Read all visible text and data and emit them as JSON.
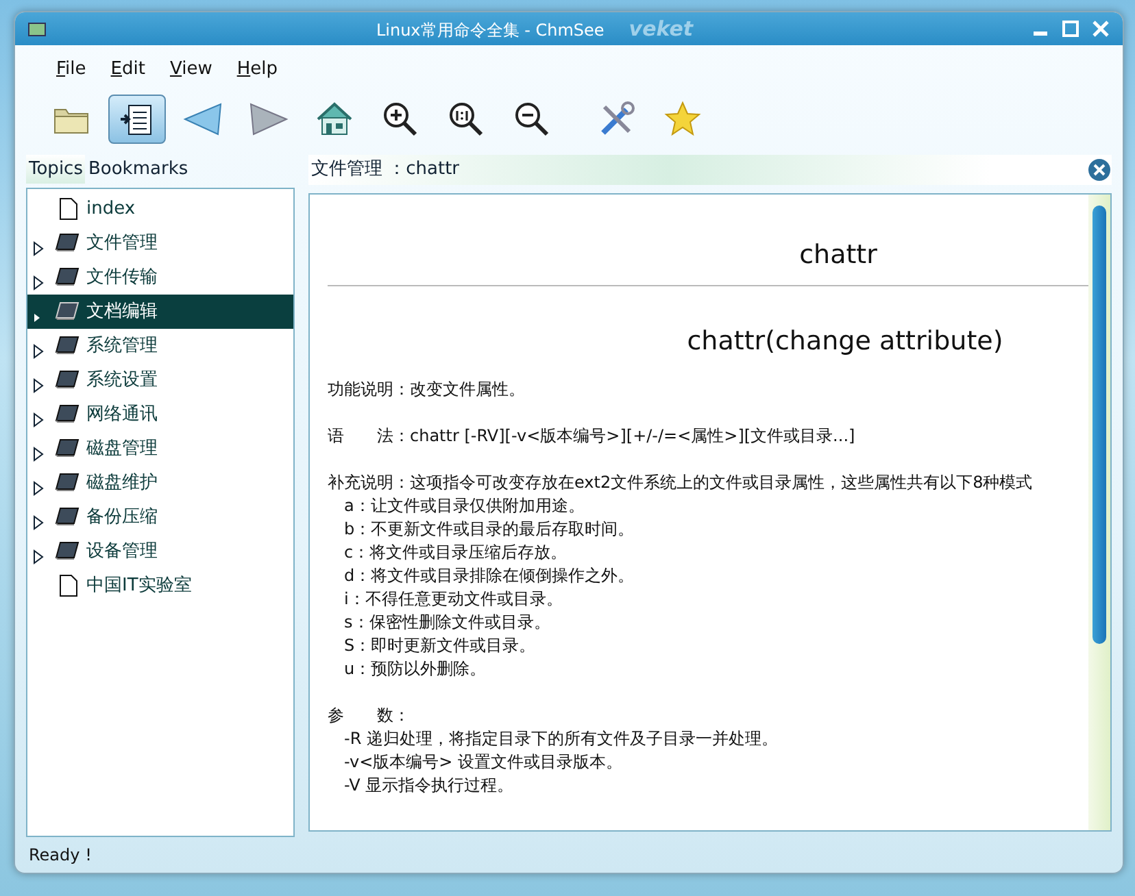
{
  "window": {
    "title": "Linux常用命令全集 - ChmSee",
    "theme_logo": "veket"
  },
  "menu": [
    "File",
    "Edit",
    "View",
    "Help"
  ],
  "toolbar": [
    {
      "kind": "open",
      "selected": false
    },
    {
      "kind": "sidebar",
      "selected": true
    },
    {
      "kind": "back",
      "selected": false
    },
    {
      "kind": "forward",
      "selected": false
    },
    {
      "kind": "home",
      "selected": false
    },
    {
      "kind": "zoom-in",
      "selected": false
    },
    {
      "kind": "zoom-reset",
      "selected": false
    },
    {
      "kind": "zoom-out",
      "selected": false
    },
    {
      "kind": "tools",
      "selected": false
    },
    {
      "kind": "bookmark",
      "selected": false
    }
  ],
  "sidebar": {
    "tabs": [
      {
        "label": "Topics",
        "selected": true
      },
      {
        "label": "Bookmarks",
        "selected": false
      }
    ],
    "items": [
      {
        "label": "index",
        "kind": "page",
        "selected": false
      },
      {
        "label": "文件管理",
        "kind": "book",
        "selected": false
      },
      {
        "label": "文件传输",
        "kind": "book",
        "selected": false
      },
      {
        "label": "文档编辑",
        "kind": "book",
        "selected": true
      },
      {
        "label": "系统管理",
        "kind": "book",
        "selected": false
      },
      {
        "label": "系统设置",
        "kind": "book",
        "selected": false
      },
      {
        "label": "网络通讯",
        "kind": "book",
        "selected": false
      },
      {
        "label": "磁盘管理",
        "kind": "book",
        "selected": false
      },
      {
        "label": "磁盘维护",
        "kind": "book",
        "selected": false
      },
      {
        "label": "备份压缩",
        "kind": "book",
        "selected": false
      },
      {
        "label": "设备管理",
        "kind": "book",
        "selected": false
      },
      {
        "label": "中国IT实验室",
        "kind": "page",
        "selected": false
      }
    ]
  },
  "page_tab": {
    "label": "文件管理 ：chattr"
  },
  "content": {
    "title": "chattr",
    "heading": "chattr(change attribute)",
    "lines": [
      {
        "kind": "para",
        "text": "功能说明：改变文件属性。"
      },
      {
        "kind": "para",
        "text": "语　　法：chattr [-RV][-v<版本编号>][+/-/=<属性>][文件或目录...]"
      },
      {
        "kind": "para",
        "text": "补充说明：这项指令可改变存放在ext2文件系统上的文件或目录属性，这些属性共有以下8种模式"
      },
      {
        "kind": "indent",
        "text": "a：让文件或目录仅供附加用途。"
      },
      {
        "kind": "indent",
        "text": "b：不更新文件或目录的最后存取时间。"
      },
      {
        "kind": "indent",
        "text": "c：将文件或目录压缩后存放。"
      },
      {
        "kind": "indent",
        "text": "d：将文件或目录排除在倾倒操作之外。"
      },
      {
        "kind": "indent",
        "text": "i：不得任意更动文件或目录。"
      },
      {
        "kind": "indent",
        "text": "s：保密性删除文件或目录。"
      },
      {
        "kind": "indent",
        "text": "S：即时更新文件或目录。"
      },
      {
        "kind": "indent",
        "text": "u：预防以外删除。"
      },
      {
        "kind": "para",
        "text": "参　　数："
      },
      {
        "kind": "indent",
        "text": "-R  递归处理，将指定目录下的所有文件及子目录一并处理。"
      },
      {
        "kind": "indent",
        "text": "-v<版本编号>  设置文件或目录版本。"
      },
      {
        "kind": "indent",
        "text": "-V  显示指令执行过程。"
      }
    ]
  },
  "status_bar": "Ready !"
}
